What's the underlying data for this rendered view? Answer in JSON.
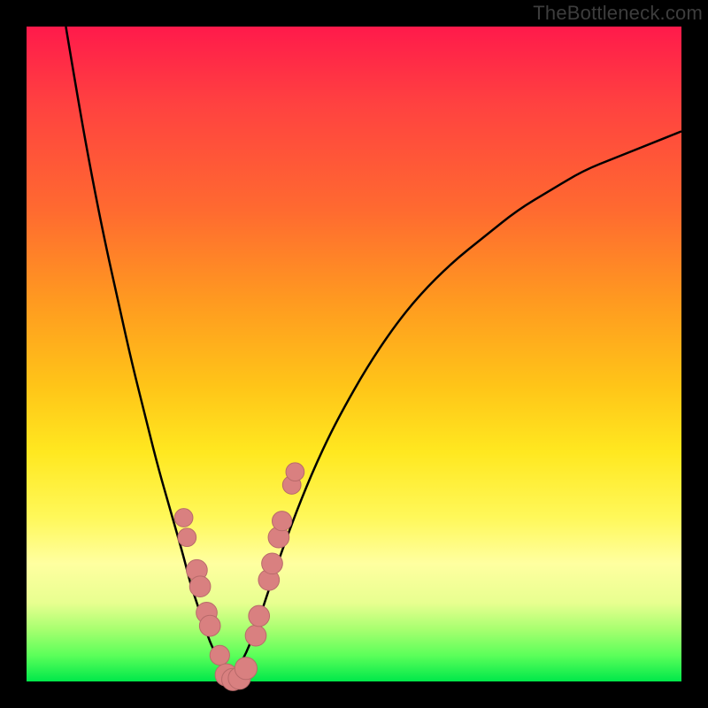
{
  "watermark": "TheBottleneck.com",
  "colors": {
    "frame": "#000000",
    "gradient_top": "#ff1a4b",
    "gradient_bottom": "#00e84a",
    "curve": "#000000",
    "marker_fill": "#d98080",
    "marker_stroke": "#b86a6a"
  },
  "chart_data": {
    "type": "line",
    "title": "",
    "xlabel": "",
    "ylabel": "",
    "xlim": [
      0,
      100
    ],
    "ylim": [
      0,
      100
    ],
    "grid": false,
    "legend": false,
    "series": [
      {
        "name": "left-curve",
        "x": [
          6,
          8,
          10,
          12,
          14,
          16,
          18,
          20,
          22,
          24,
          25,
          26,
          27,
          28,
          29,
          30,
          31
        ],
        "y": [
          100,
          88,
          77,
          67,
          58,
          49,
          41,
          33,
          26,
          19,
          15,
          12,
          9,
          6,
          4,
          2,
          0
        ]
      },
      {
        "name": "right-curve",
        "x": [
          31,
          33,
          35,
          37,
          39,
          42,
          45,
          48,
          52,
          56,
          60,
          65,
          70,
          75,
          80,
          85,
          90,
          95,
          100
        ],
        "y": [
          0,
          3,
          8,
          14,
          20,
          28,
          35,
          41,
          48,
          54,
          59,
          64,
          68,
          72,
          75,
          78,
          80,
          82,
          84
        ]
      }
    ],
    "markers": [
      {
        "x": 24.0,
        "y": 25.0,
        "r": 1.4
      },
      {
        "x": 24.5,
        "y": 22.0,
        "r": 1.4
      },
      {
        "x": 26.0,
        "y": 17.0,
        "r": 1.6
      },
      {
        "x": 26.5,
        "y": 14.5,
        "r": 1.6
      },
      {
        "x": 27.5,
        "y": 10.5,
        "r": 1.6
      },
      {
        "x": 28.0,
        "y": 8.5,
        "r": 1.6
      },
      {
        "x": 29.5,
        "y": 4.0,
        "r": 1.5
      },
      {
        "x": 30.5,
        "y": 1.0,
        "r": 1.7
      },
      {
        "x": 31.5,
        "y": 0.3,
        "r": 1.7
      },
      {
        "x": 32.5,
        "y": 0.5,
        "r": 1.7
      },
      {
        "x": 33.5,
        "y": 2.0,
        "r": 1.7
      },
      {
        "x": 35.0,
        "y": 7.0,
        "r": 1.6
      },
      {
        "x": 35.5,
        "y": 10.0,
        "r": 1.6
      },
      {
        "x": 37.0,
        "y": 15.5,
        "r": 1.6
      },
      {
        "x": 37.5,
        "y": 18.0,
        "r": 1.6
      },
      {
        "x": 38.5,
        "y": 22.0,
        "r": 1.6
      },
      {
        "x": 39.0,
        "y": 24.5,
        "r": 1.5
      },
      {
        "x": 40.5,
        "y": 30.0,
        "r": 1.4
      },
      {
        "x": 41.0,
        "y": 32.0,
        "r": 1.4
      }
    ]
  }
}
